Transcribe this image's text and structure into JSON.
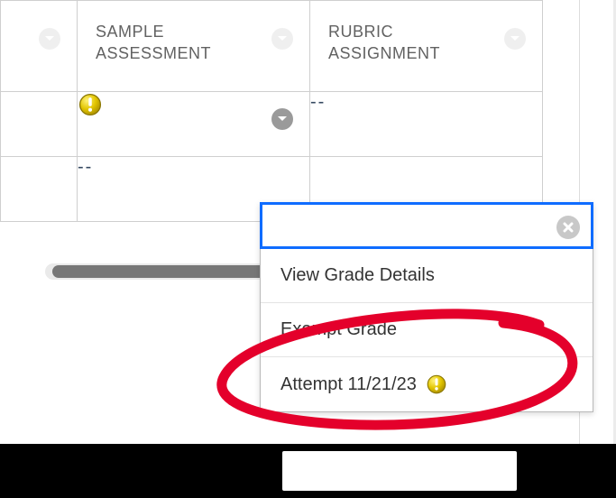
{
  "columns": {
    "col0_label": "",
    "col1_label": "SAMPLE ASSESSMENT",
    "col2_label": "RUBRIC ASSIGNMENT"
  },
  "rows": [
    {
      "col0": "",
      "col1_icon": "alert",
      "col2": "--"
    },
    {
      "col0": "",
      "col1": "--",
      "col2": ""
    }
  ],
  "menu": {
    "input_value": "",
    "close_label": "close",
    "items": [
      {
        "label": "View Grade Details"
      },
      {
        "label": "Exempt Grade"
      },
      {
        "label": "Attempt 11/21/23",
        "icon": "alert"
      }
    ]
  },
  "icons": {
    "chevron": "chevron-down",
    "alert": "needs-grading"
  },
  "colors": {
    "highlight": "#e4002b",
    "focus": "#0f6cff"
  }
}
